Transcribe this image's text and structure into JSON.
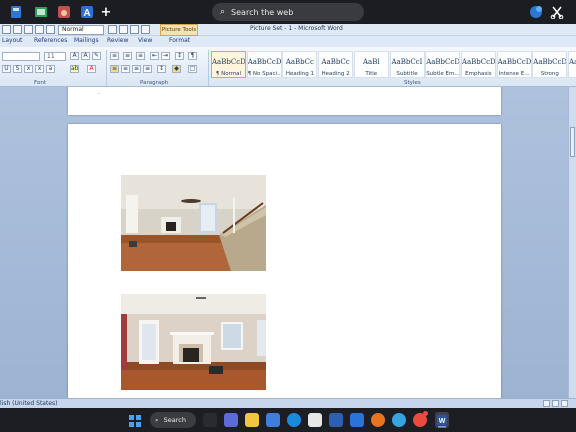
{
  "taskbar_top": {
    "search_placeholder": "Search the web",
    "search_icon": "magnifier-icon",
    "new_tab_label": "+"
  },
  "word": {
    "style_dropdown_value": "Normal",
    "contextual_tab": "Picture Tools",
    "title": "Picture Set - 1 - Microsoft Word",
    "tabs": [
      "Layout",
      "References",
      "Mailings",
      "Review",
      "View",
      "Format"
    ],
    "groups": {
      "font": "Font",
      "paragraph": "Paragraph",
      "styles": "Styles"
    },
    "font_size_value": "11",
    "styles": [
      {
        "sample": "AaBbCcDc",
        "name": "¶ Normal",
        "selected": true
      },
      {
        "sample": "AaBbCcDc",
        "name": "¶ No Spaci...",
        "selected": false
      },
      {
        "sample": "AaBbCc",
        "name": "Heading 1",
        "selected": false
      },
      {
        "sample": "AaBbCc",
        "name": "Heading 2",
        "selected": false
      },
      {
        "sample": "AaBl",
        "name": "Title",
        "selected": false
      },
      {
        "sample": "AaBbCcI",
        "name": "Subtitle",
        "selected": false
      },
      {
        "sample": "AaBbCcDc",
        "name": "Subtle Em...",
        "selected": false
      },
      {
        "sample": "AaBbCcDc",
        "name": "Emphasis",
        "selected": false
      },
      {
        "sample": "AaBbCcDc",
        "name": "Intense E...",
        "selected": false
      },
      {
        "sample": "AaBbCcDc",
        "name": "Strong",
        "selected": false
      },
      {
        "sample": "AaBbCcDc",
        "name": "Quo",
        "selected": false
      }
    ],
    "status_language": "lish (United States)"
  },
  "taskbar_bottom": {
    "search_label": "Search"
  },
  "colors": {
    "ribbon_bg": "#dbe6f4",
    "doc_bg": "#a9bedb",
    "taskbar": "#1d1d24",
    "highlight": "#e8a33a"
  }
}
